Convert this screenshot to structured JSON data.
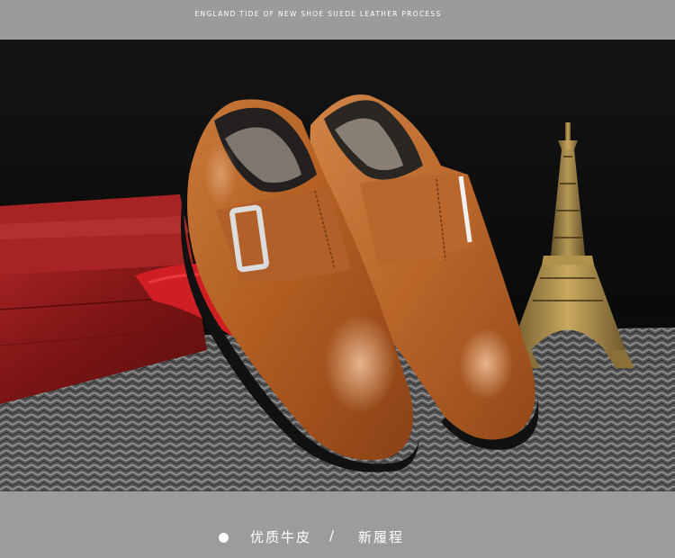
{
  "header": {
    "caption": "ENGLAND TIDE OF NEW SHOE SUEDE LEATHER PROCESS"
  },
  "photo": {
    "subject": "brown leather monk-strap shoes"
  },
  "footer": {
    "feature_1": "优质牛皮",
    "separator": "/",
    "feature_2": "新履程"
  },
  "colors": {
    "bar_gray": "#9c9c9c",
    "leather_brown": "#b8642a",
    "box_red": "#8e1c1c",
    "text_white": "#ffffff"
  }
}
